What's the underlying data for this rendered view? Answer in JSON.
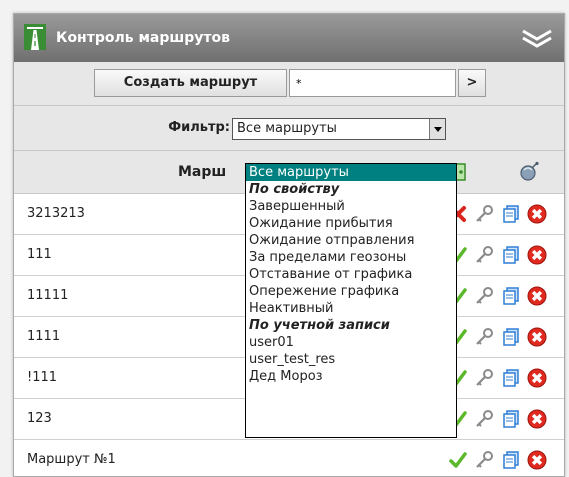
{
  "window": {
    "title": "Контроль маршрутов"
  },
  "toolbar": {
    "create_label": "Создать маршрут",
    "name_value": "*",
    "go_label": ">"
  },
  "filter": {
    "label": "Фильтр:",
    "selected": "Все маршруты"
  },
  "table": {
    "column_route": "Марш",
    "rows": [
      {
        "name": "3213213",
        "status": "error"
      },
      {
        "name": "111",
        "status": "ok"
      },
      {
        "name": "11111",
        "status": "ok"
      },
      {
        "name": "1111",
        "status": "ok"
      },
      {
        "name": "!111",
        "status": "ok"
      },
      {
        "name": "123",
        "status": "ok"
      },
      {
        "name": "Маршрут №1",
        "status": "ok"
      }
    ]
  },
  "dropdown": {
    "items": [
      {
        "label": "Все маршруты",
        "kind": "option",
        "selected": true
      },
      {
        "label": "По свойству",
        "kind": "group"
      },
      {
        "label": "Завершенный",
        "kind": "option"
      },
      {
        "label": "Ожидание прибытия",
        "kind": "option"
      },
      {
        "label": "Ожидание отправления",
        "kind": "option"
      },
      {
        "label": "За пределами геозоны",
        "kind": "option"
      },
      {
        "label": "Отставание от графика",
        "kind": "option"
      },
      {
        "label": "Опережение графика",
        "kind": "option"
      },
      {
        "label": "Неактивный",
        "kind": "option"
      },
      {
        "label": "По учетной записи",
        "kind": "group"
      },
      {
        "label": "user01",
        "kind": "option"
      },
      {
        "label": "user_test_res",
        "kind": "option"
      },
      {
        "label": "Дед Мороз",
        "kind": "option"
      }
    ]
  },
  "icons": {
    "app": "road-icon",
    "collapse": "chevron-down-icon",
    "header": [
      "tag-icon",
      "satellite-icon"
    ],
    "row_actions": [
      "status-icon",
      "key-icon",
      "copy-icon",
      "delete-icon"
    ]
  },
  "colors": {
    "titlebar": "#808080",
    "selection": "#008080",
    "ok": "#5cb82b",
    "error": "#d9231b",
    "delete": "#e02a1f",
    "copy": "#2f7fd6"
  }
}
